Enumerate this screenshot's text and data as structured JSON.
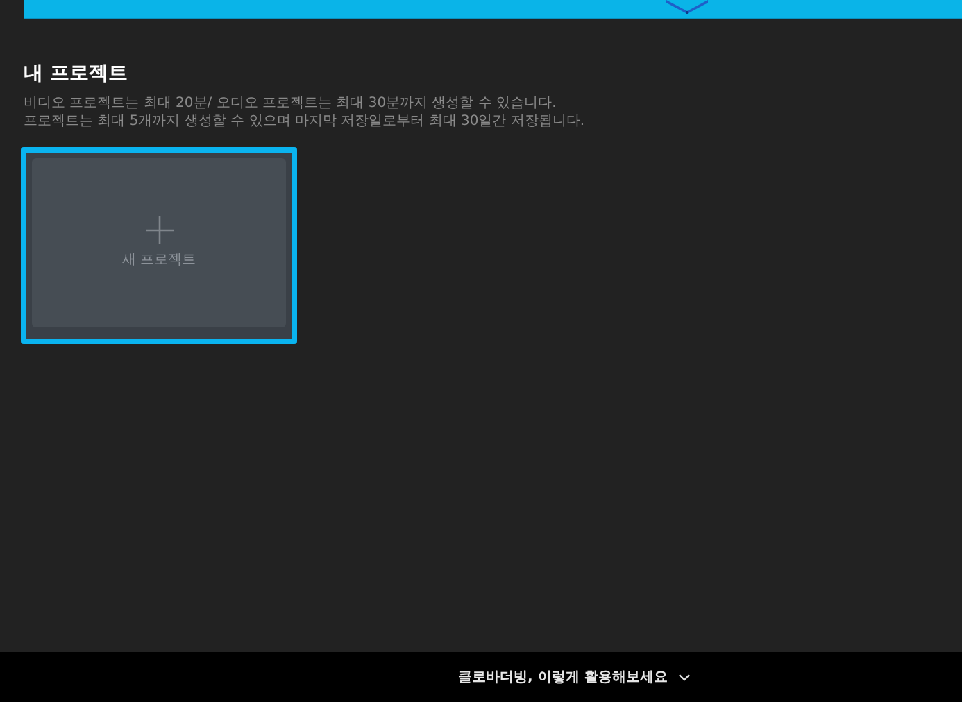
{
  "section": {
    "title": "내 프로젝트",
    "description": [
      "비디오 프로젝트는 최대 20분/ 오디오 프로젝트는 최대 30분까지 생성할 수 있습니다.",
      "프로젝트는 최대 5개까지 생성할 수 있으며 마지막 저장일로부터 최대 30일간 저장됩니다."
    ]
  },
  "projects": [
    {
      "kind": "new",
      "label": "새 프로젝트",
      "selected": true
    }
  ],
  "footer": {
    "label": "클로바더빙, 이렇게 활용해보세요",
    "expanded": false
  }
}
